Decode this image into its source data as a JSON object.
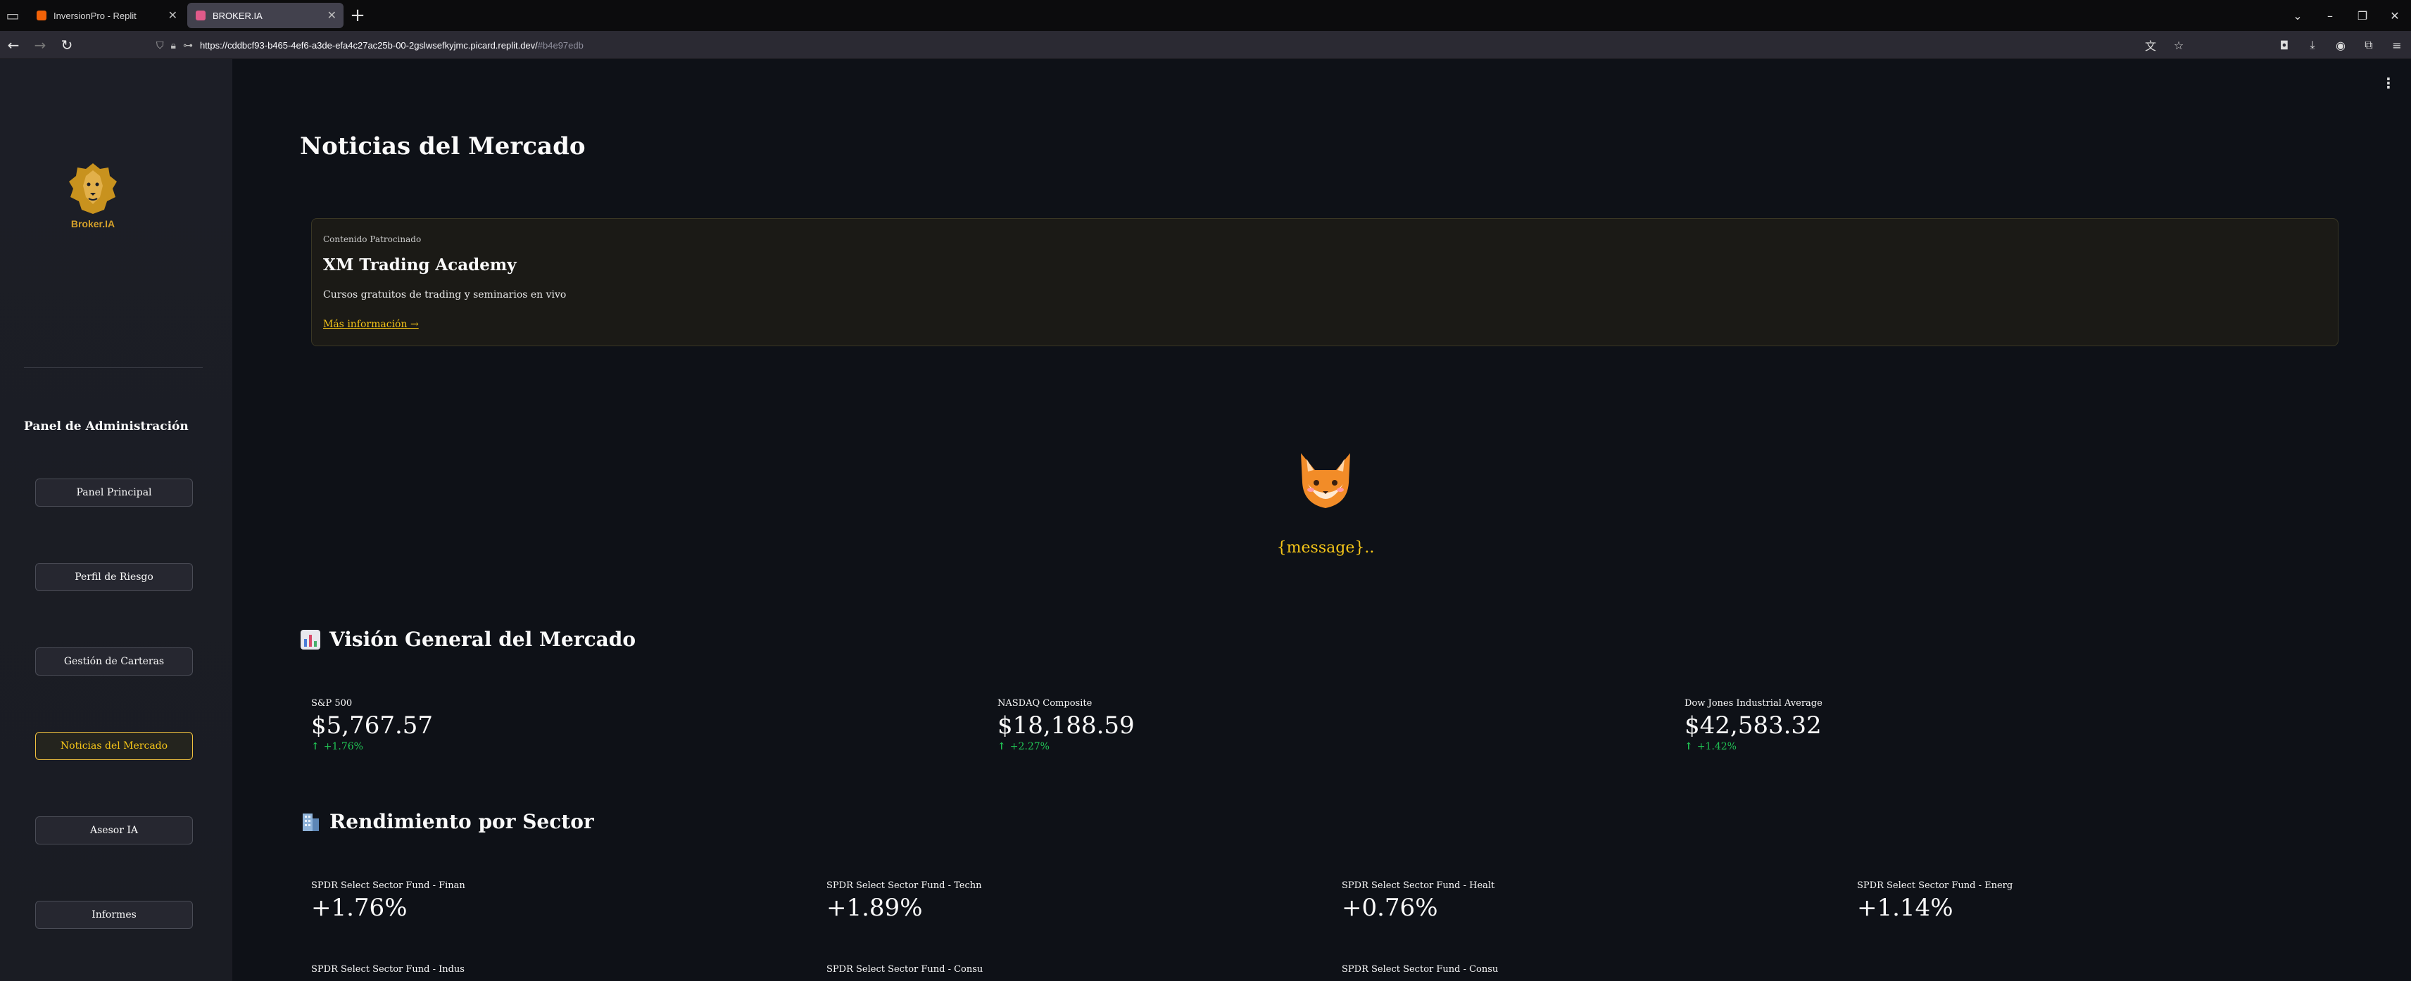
{
  "browser": {
    "tabs": [
      {
        "title": "InversionPro - Replit",
        "active": false,
        "favicon_color": "#f26207"
      },
      {
        "title": "BROKER.IA",
        "active": true,
        "favicon_color": "#e05a8a"
      }
    ],
    "url": "https://cddbcf93-b465-4ef6-a3de-efa4c27ac25b-00-2gslwsefkyjmc.picard.replit.dev/",
    "url_hash": "#b4e97edb"
  },
  "sidebar": {
    "logo_text": "Broker.IA",
    "admin_title": "Panel de Administración",
    "items": [
      {
        "label": "Panel Principal",
        "active": false
      },
      {
        "label": "Perfil de Riesgo",
        "active": false
      },
      {
        "label": "Gestión de Carteras",
        "active": false
      },
      {
        "label": "Noticias del Mercado",
        "active": true
      },
      {
        "label": "Asesor IA",
        "active": false
      },
      {
        "label": "Informes",
        "active": false
      }
    ]
  },
  "main": {
    "page_title": "Noticias del Mercado",
    "sponsor": {
      "tag": "Contenido Patrocinado",
      "title": "XM Trading Academy",
      "description": "Cursos gratuitos de trading y seminarios en vivo",
      "link": "Más información →"
    },
    "loading_message": "{message}..",
    "overview": {
      "title": "Visión General del Mercado",
      "icon": "bar-chart-emoji",
      "metrics": [
        {
          "label": "S&P 500",
          "value": "$5,767.57",
          "delta": "+1.76%"
        },
        {
          "label": "NASDAQ Composite",
          "value": "$18,188.59",
          "delta": "+2.27%"
        },
        {
          "label": "Dow Jones Industrial Average",
          "value": "$42,583.32",
          "delta": "+1.42%"
        }
      ]
    },
    "sectors": {
      "title": "Rendimiento por Sector",
      "icon": "office-building-emoji",
      "metrics": [
        {
          "label": "SPDR Select Sector Fund - Finan",
          "value": "+1.76%"
        },
        {
          "label": "SPDR Select Sector Fund - Techn",
          "value": "+1.89%"
        },
        {
          "label": "SPDR Select Sector Fund - Healt",
          "value": "+0.76%"
        },
        {
          "label": "SPDR Select Sector Fund - Energ",
          "value": "+1.14%"
        },
        {
          "label": "SPDR Select Sector Fund - Indus",
          "value": ""
        },
        {
          "label": "SPDR Select Sector Fund - Consu",
          "value": ""
        },
        {
          "label": "SPDR Select Sector Fund - Consu",
          "value": ""
        }
      ]
    }
  },
  "colors": {
    "accent": "#f5c518",
    "positive": "#21c354",
    "background": "#0e1117",
    "sidebar": "#1c1e26"
  }
}
